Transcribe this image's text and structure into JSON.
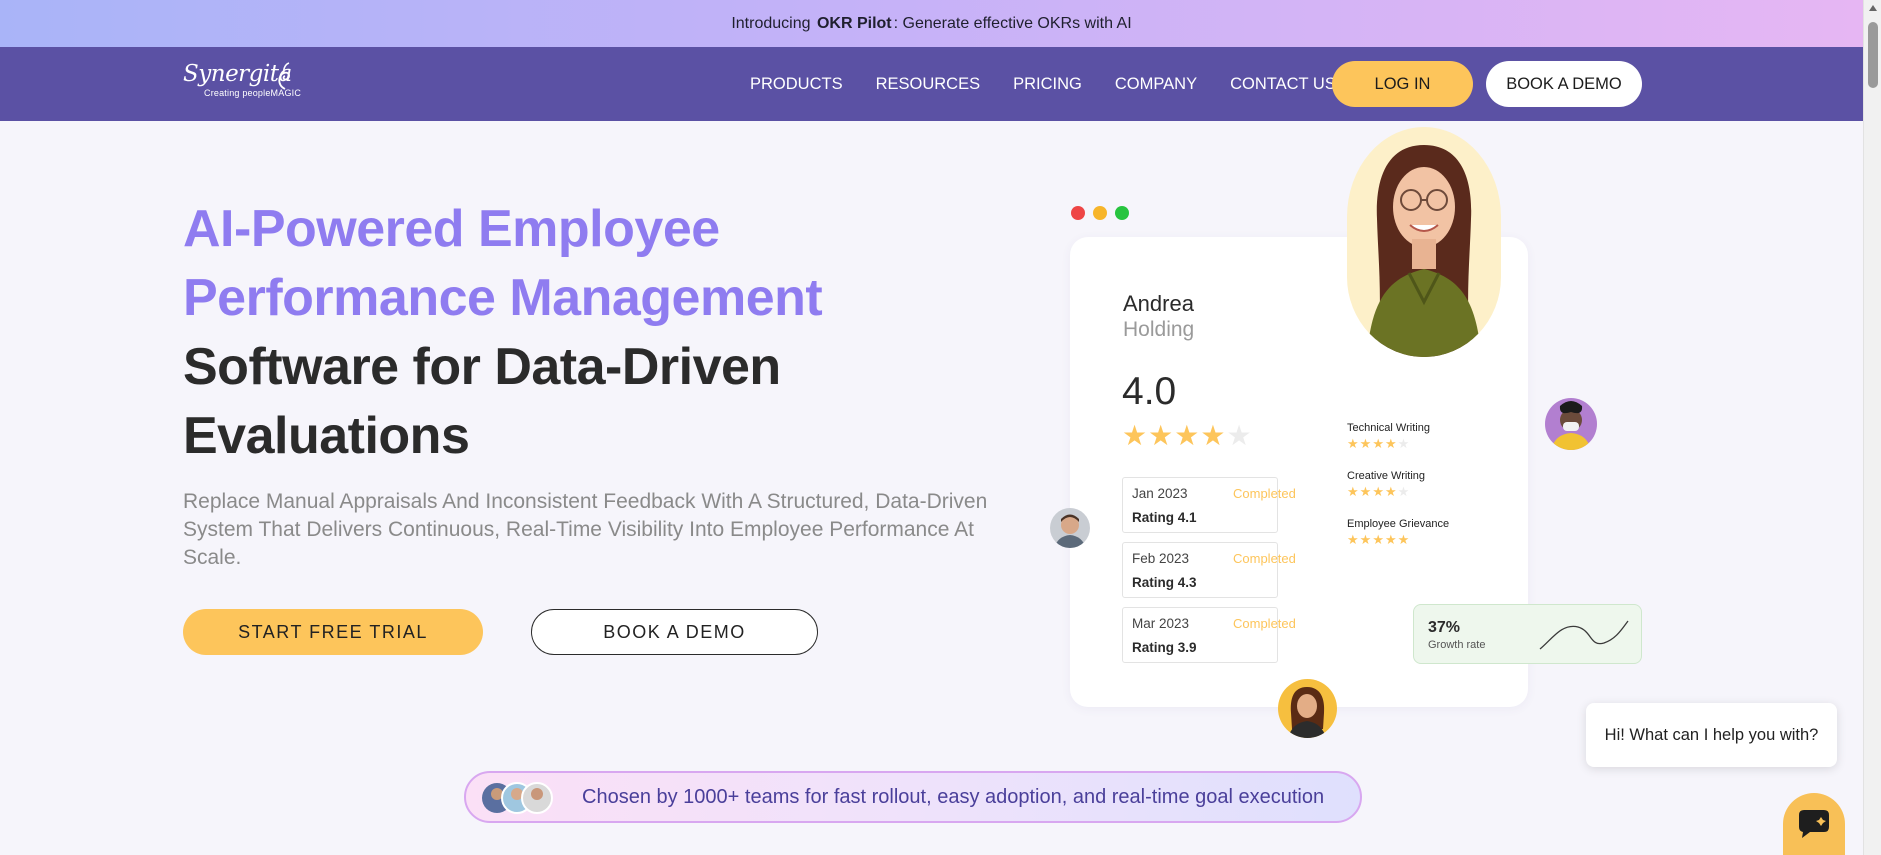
{
  "announcement": {
    "prefix": "Introducing",
    "product": "OKR Pilot",
    "suffix": ": Generate effective OKRs with AI"
  },
  "nav": {
    "logo_text": "Synergita",
    "logo_tagline": "Creating peopleMAGIC",
    "links": [
      "PRODUCTS",
      "RESOURCES",
      "PRICING",
      "COMPANY",
      "CONTACT US"
    ],
    "login_label": "LOG IN",
    "demo_label": "BOOK A DEMO"
  },
  "hero": {
    "title_line1": "AI-Powered Employee",
    "title_line2": "Performance Management",
    "title_line3": "Software for Data-Driven",
    "title_line4": "Evaluations",
    "subtitle": "Replace Manual Appraisals And Inconsistent Feedback With A Structured, Data-Driven System That Delivers Continuous, Real-Time Visibility Into Employee Performance At Scale.",
    "primary_cta": "START FREE TRIAL",
    "secondary_cta": "BOOK A DEMO"
  },
  "profile_card": {
    "name": "Andrea",
    "company": "Holding",
    "overall_rating": "4.0",
    "overall_stars": 4,
    "history": [
      {
        "month": "Jan 2023",
        "status": "Completed",
        "rating": "Rating 4.1"
      },
      {
        "month": "Feb 2023",
        "status": "Completed",
        "rating": "Rating 4.3"
      },
      {
        "month": "Mar 2023",
        "status": "Completed",
        "rating": "Rating 3.9"
      }
    ],
    "skills": [
      {
        "name": "Technical Writing",
        "stars": 4
      },
      {
        "name": "Creative Writing",
        "stars": 4
      },
      {
        "name": "Employee Grievance",
        "stars": 5
      }
    ],
    "growth": {
      "value": "37%",
      "label": "Growth rate"
    }
  },
  "window_dot_colors": [
    "#ee4545",
    "#f7b52a",
    "#27c43f"
  ],
  "colors": {
    "accent_purple": "#8f7cf0",
    "nav_bg": "#5b51a4",
    "cta_yellow": "#fdc55b"
  },
  "chat": {
    "greeting": "Hi! What can I help you with?"
  },
  "social_proof": {
    "text": "Chosen by 1000+ teams for fast rollout, easy adoption, and real-time goal execution"
  }
}
